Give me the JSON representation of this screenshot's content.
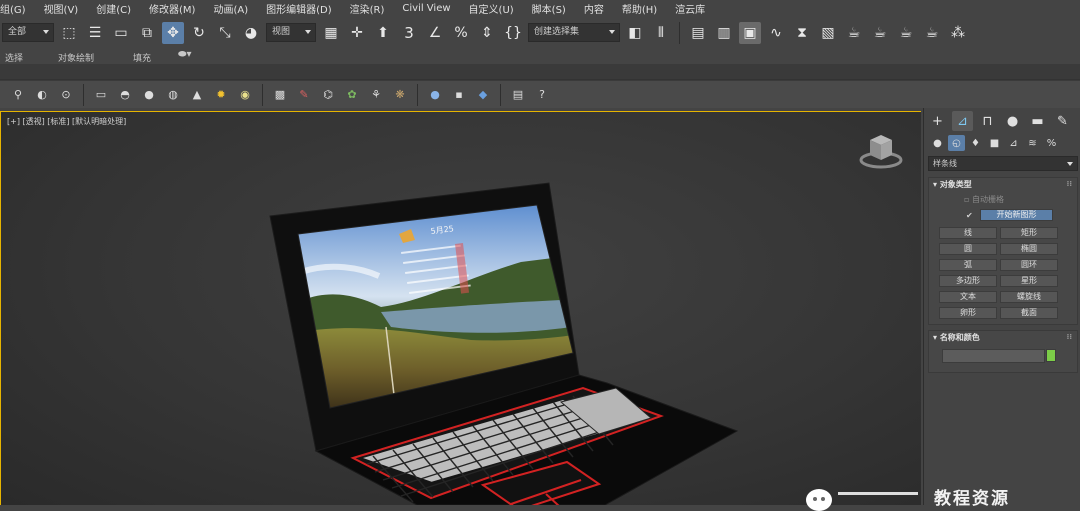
{
  "menu": [
    "组(G)",
    "视图(V)",
    "创建(C)",
    "修改器(M)",
    "动画(A)",
    "图形编辑器(D)",
    "渲染(R)",
    "Civil View",
    "自定义(U)",
    "脚本(S)",
    "内容",
    "帮助(H)",
    "渲云库"
  ],
  "toolbar": {
    "filter_combo": "全部",
    "coord_combo": "视图",
    "selset_combo": "创建选择集",
    "snap_label": "3"
  },
  "ribbon": {
    "tab_select": "选择",
    "tab_object_paint": "对象绘制",
    "tab_fill": "填充"
  },
  "viewport": {
    "label": "[+] [透视] [标准] [默认明暗处理]"
  },
  "screen": {
    "month": "5月25"
  },
  "cmdpanel": {
    "category": "样条线",
    "object_type": {
      "title": "对象类型",
      "autogrid": "自动栅格",
      "start_new_shape": "开始新图形",
      "buttons": [
        "线",
        "矩形",
        "圆",
        "椭圆",
        "弧",
        "圆环",
        "多边形",
        "星形",
        "文本",
        "螺旋线",
        "卵形",
        "截面"
      ]
    },
    "name_color": {
      "title": "名称和颜色",
      "color": "#7ccd48"
    }
  },
  "watermark": {
    "text": "教程资源"
  },
  "colors": {
    "accent": "#5b7fa8",
    "viewport_border": "#e6b400",
    "keyboard_outline": "#d22222"
  }
}
